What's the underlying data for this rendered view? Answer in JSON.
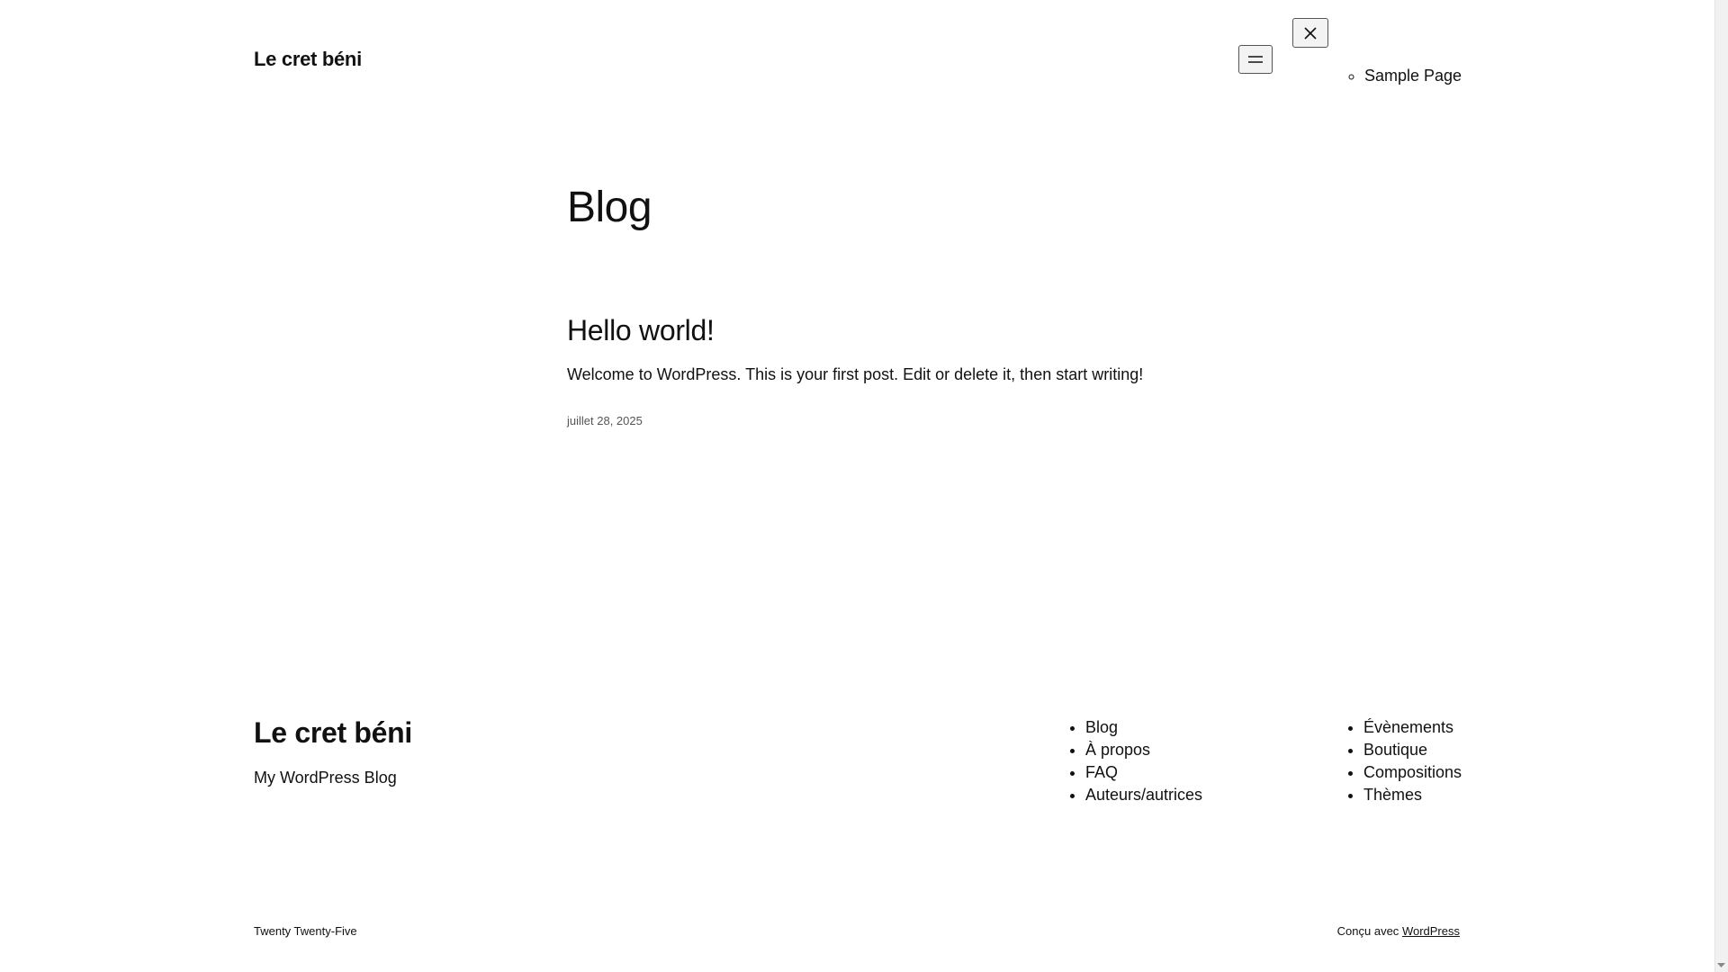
{
  "header": {
    "site_title": "Le cret béni",
    "menu_open_icon": "hamburger-menu-icon",
    "menu_close_icon": "close-icon",
    "nav_items": [
      {
        "label": "Sample Page"
      }
    ]
  },
  "main": {
    "page_heading": "Blog",
    "posts": [
      {
        "title": "Hello world!",
        "excerpt": "Welcome to WordPress. This is your first post. Edit or delete it, then start writing!",
        "date": "juillet 28, 2025"
      }
    ]
  },
  "footer": {
    "site_title": "Le cret béni",
    "tagline": "My WordPress Blog",
    "nav_column_1": [
      {
        "label": "Blog"
      },
      {
        "label": "À propos"
      },
      {
        "label": "FAQ"
      },
      {
        "label": "Auteurs/autrices"
      }
    ],
    "nav_column_2": [
      {
        "label": "Évènements"
      },
      {
        "label": "Boutique"
      },
      {
        "label": "Compositions"
      },
      {
        "label": "Thèmes"
      }
    ],
    "credit": "Twenty Twenty-Five",
    "powered_prefix": "Conçu avec",
    "powered_link": "WordPress"
  },
  "colors": {
    "text": "#111111",
    "muted": "#555555",
    "background": "#ffffff"
  }
}
